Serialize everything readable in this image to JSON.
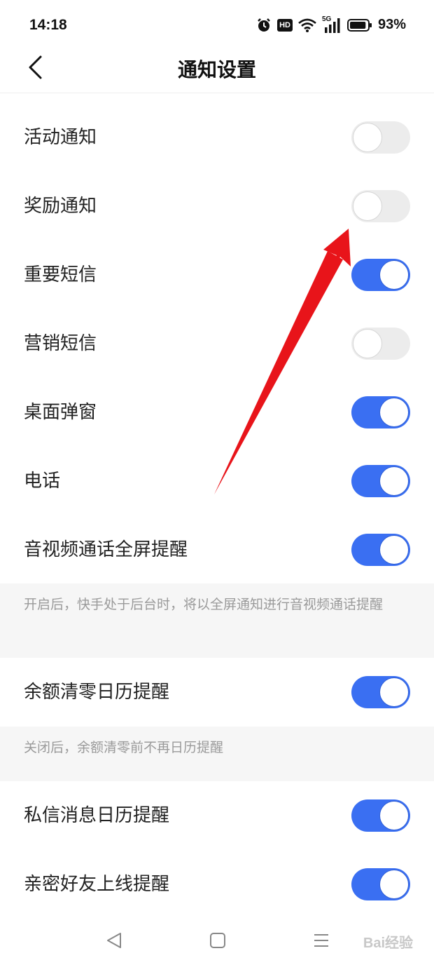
{
  "status_bar": {
    "time": "14:18",
    "hd": "HD",
    "network": "5G",
    "battery": "93%",
    "battery_level": 0.93
  },
  "header": {
    "title": "通知设置",
    "back_icon": "chevron-left-icon"
  },
  "settings": [
    {
      "label": "活动通知",
      "enabled": false
    },
    {
      "label": "奖励通知",
      "enabled": false
    },
    {
      "label": "重要短信",
      "enabled": true
    },
    {
      "label": "营销短信",
      "enabled": false
    },
    {
      "label": "桌面弹窗",
      "enabled": true
    },
    {
      "label": "电话",
      "enabled": true
    },
    {
      "label": "音视频通话全屏提醒",
      "enabled": true
    },
    {
      "label": "余额清零日历提醒",
      "enabled": true
    },
    {
      "label": "私信消息日历提醒",
      "enabled": true
    },
    {
      "label": "亲密好友上线提醒",
      "enabled": true
    }
  ],
  "hints": {
    "fullscreen": "开启后，快手处于后台时，将以全屏通知进行音视频通话提醒",
    "balance": "关闭后，余额清零前不再日历提醒"
  },
  "bottom_nav": {
    "back": "triangle-back-icon",
    "home": "square-home-icon",
    "menu": "menu-lines-icon"
  },
  "watermark": "Bai经验",
  "colors": {
    "accent": "#3a6ff2",
    "toggle_off": "#ececec",
    "arrow": "#e8141a"
  }
}
